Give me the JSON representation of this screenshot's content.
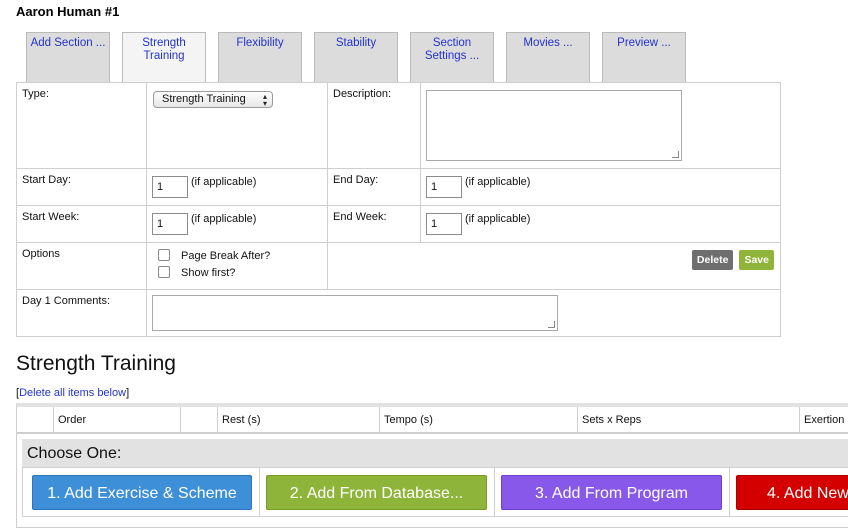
{
  "page": {
    "title": "Aaron Human #1"
  },
  "tabs": [
    {
      "label": "Add Section ..."
    },
    {
      "label": "Strength Training",
      "active": true
    },
    {
      "label": "Flexibility"
    },
    {
      "label": "Stability"
    },
    {
      "label": "Section Settings ..."
    },
    {
      "label": "Movies ..."
    },
    {
      "label": "Preview ..."
    }
  ],
  "form": {
    "type_label": "Type:",
    "type_value": "Strength Training",
    "description_label": "Description:",
    "description_value": "",
    "start_day_label": "Start Day:",
    "start_day_value": "1",
    "end_day_label": "End Day:",
    "end_day_value": "1",
    "start_week_label": "Start Week:",
    "start_week_value": "1",
    "end_week_label": "End Week:",
    "end_week_value": "1",
    "if_applicable": "(if applicable)",
    "options_label": "Options",
    "option_page_break": "Page Break After?",
    "option_show_first": "Show first?",
    "delete_label": "Delete",
    "save_label": "Save",
    "day1_comments_label": "Day 1 Comments:",
    "day1_comments_value": ""
  },
  "section": {
    "heading": "Strength Training",
    "delete_all_open": "[",
    "delete_all_link": "Delete all items below",
    "delete_all_close": "]"
  },
  "grid": {
    "columns": [
      "",
      "Order",
      "",
      "Rest (s)",
      "Tempo (s)",
      "Sets x Reps",
      "Exertion"
    ]
  },
  "choose": {
    "label": "Choose One:",
    "buttons": [
      "1. Add Exercise & Scheme",
      "2. Add From Database...",
      "3. Add From Program",
      "4. Add New"
    ]
  },
  "colors": {
    "blue_button": "#3d8fd8",
    "green_button": "#8fb43a",
    "purple_button": "#8758ea",
    "red_button": "#d40000",
    "delete_button": "#6e6e6e",
    "link": "#2233cc"
  }
}
